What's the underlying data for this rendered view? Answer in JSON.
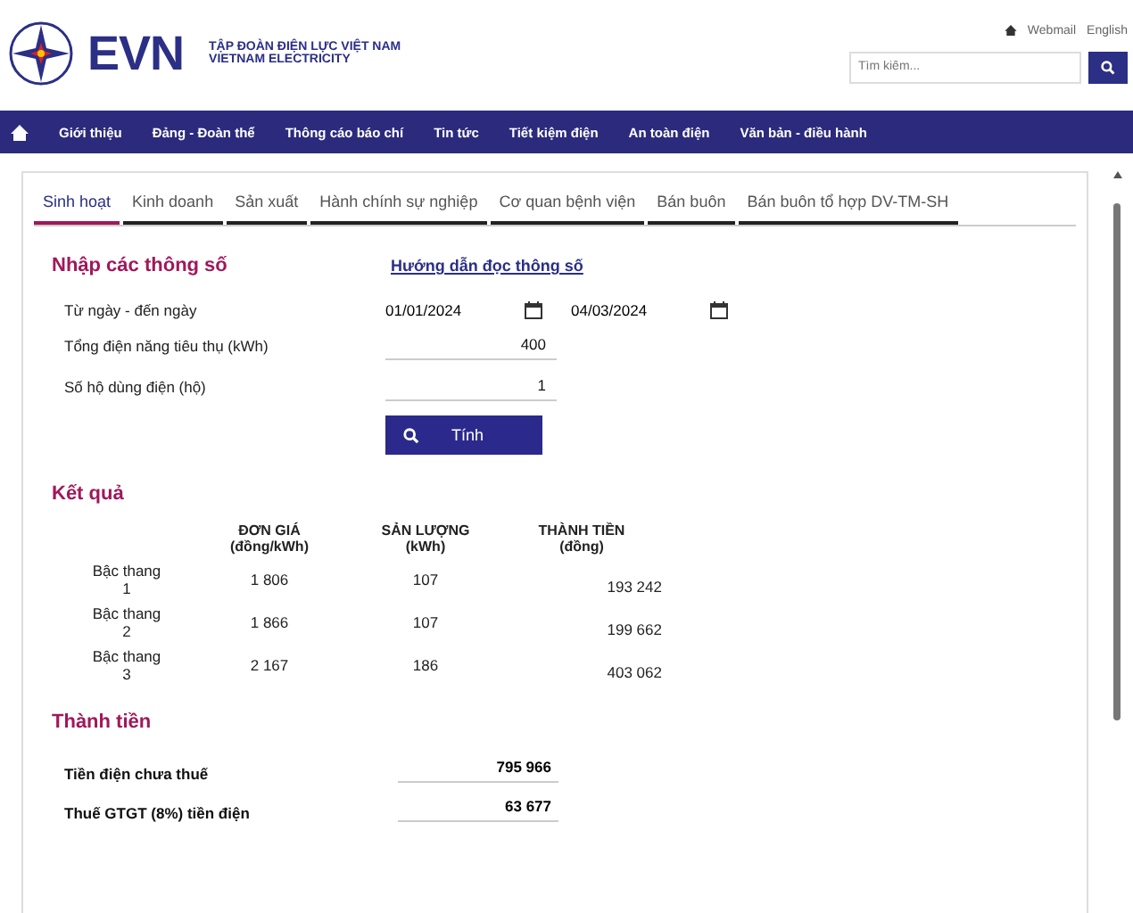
{
  "header": {
    "brand": "EVN",
    "tagline_1": "TẬP ĐOÀN ĐIỆN LỰC VIỆT NAM",
    "tagline_2": "VIETNAM ELECTRICITY",
    "top_links": [
      "Webmail",
      "English"
    ],
    "search": {
      "placeholder": "Tìm kiếm..."
    }
  },
  "nav": [
    "Giới thiệu",
    "Đảng - Đoàn thể",
    "Thông cáo báo chí",
    "Tin tức",
    "Tiết kiệm điện",
    "An toàn điện",
    "Văn bản - điều hành"
  ],
  "tabs": [
    {
      "label": "Sinh hoạt",
      "selected": true
    },
    {
      "label": "Kinh doanh",
      "selected": false
    },
    {
      "label": "Sản xuất",
      "selected": false
    },
    {
      "label": "Hành chính sự nghiệp",
      "selected": false
    },
    {
      "label": "Cơ quan bệnh viện",
      "selected": false
    },
    {
      "label": "Bán buôn",
      "selected": false
    },
    {
      "label": "Bán buôn tổ hợp DV-TM-SH",
      "selected": false
    }
  ],
  "input_section": {
    "title": "Nhập các thông số",
    "guide_link": "Hướng dẫn đọc thông số",
    "date_label": "Từ ngày - đến ngày",
    "date_from": "01/01/2024",
    "date_to": "04/03/2024",
    "fields": [
      {
        "label": "Tổng điện năng tiêu thụ (kWh)",
        "value": "400"
      },
      {
        "label": "Số hộ dùng điện (hộ)",
        "value": "1"
      }
    ],
    "button": "Tính"
  },
  "results": {
    "title": "Kết quả",
    "columns": [
      {
        "line_1": "ĐƠN GIÁ",
        "line_2": "(đồng/kWh)"
      },
      {
        "line_1": "SẢN LƯỢNG",
        "line_2": "(kWh)"
      },
      {
        "line_1": "THÀNH TIỀN",
        "line_2": "(đồng)"
      }
    ],
    "rows": [
      {
        "tier": "Bậc thang",
        "number": "1",
        "price": "1 806",
        "amount": "107",
        "total": "193 242"
      },
      {
        "tier": "Bậc thang",
        "number": "2",
        "price": "1 866",
        "amount": "107",
        "total": "199 662"
      },
      {
        "tier": "Bậc thang",
        "number": "3",
        "price": "2 167",
        "amount": "186",
        "total": "403 062"
      }
    ]
  },
  "totals": {
    "title": "Thành tiền",
    "rows": [
      {
        "label": "Tiền điện chưa thuế",
        "value": "795 966"
      },
      {
        "label": "Thuế GTGT (8%) tiền điện",
        "value": "63 677"
      }
    ]
  }
}
